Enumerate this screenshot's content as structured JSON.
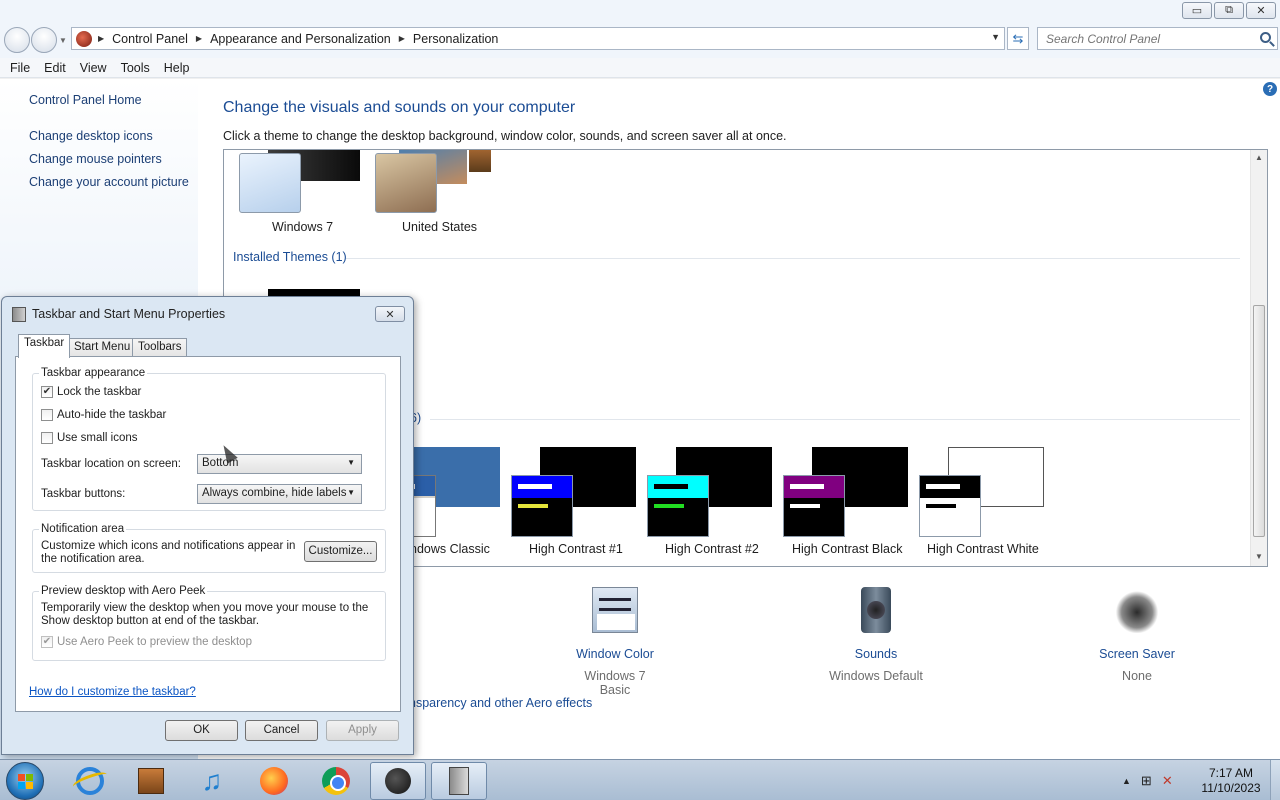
{
  "window": {
    "minimize_glyph": "▭",
    "maximize_glyph": "⧉",
    "close_glyph": "✕"
  },
  "address": {
    "crumbs": [
      "Control Panel",
      "Appearance and Personalization",
      "Personalization"
    ],
    "search_placeholder": "Search Control Panel"
  },
  "menu": [
    "File",
    "Edit",
    "View",
    "Tools",
    "Help"
  ],
  "sidebar": {
    "home": "Control Panel Home",
    "links": [
      "Change desktop icons",
      "Change mouse pointers",
      "Change your account picture"
    ]
  },
  "main": {
    "title": "Change the visuals and sounds on your computer",
    "subtitle": "Click a theme to change the desktop background, window color, sounds, and screen saver all at once.",
    "aero_themes": [
      {
        "name": "Windows 7"
      },
      {
        "name": "United States"
      }
    ],
    "installed_group": "Installed Themes (1)",
    "basic_group_suffix": "6)",
    "basic_themes": [
      {
        "name": "ndows Classic",
        "bar1": "#ffffff",
        "bar2": "#ffffff",
        "title": "#2b5fa8"
      },
      {
        "name": "High Contrast #1",
        "bar1": "#ffffff",
        "bar2": "#e5e53a",
        "title": "#0000ff"
      },
      {
        "name": "High Contrast #2",
        "bar1": "#000000",
        "bar2": "#22dd22",
        "title": "#00ffff"
      },
      {
        "name": "High Contrast Black",
        "bar1": "#ffffff",
        "bar2": "#ffffff",
        "title": "#800080"
      },
      {
        "name": "High Contrast White",
        "bar1": "#ffffff",
        "bar2": "#000000",
        "title": "#000000"
      }
    ],
    "bottom": [
      {
        "title": "Window Color",
        "sub": "Windows 7 Basic",
        "icon": "window-color-icon"
      },
      {
        "title": "Sounds",
        "sub": "Windows Default",
        "icon": "speaker-icon"
      },
      {
        "title": "Screen Saver",
        "sub": "None",
        "icon": "screen-saver-icon"
      }
    ],
    "aero_link": "nsparency and other Aero effects"
  },
  "dialog": {
    "title": "Taskbar and Start Menu Properties",
    "tabs": [
      "Taskbar",
      "Start Menu",
      "Toolbars"
    ],
    "appearance": {
      "title": "Taskbar appearance",
      "lock": {
        "label": "Lock the taskbar",
        "checked": true
      },
      "autohide": {
        "label": "Auto-hide the taskbar",
        "checked": false
      },
      "small": {
        "label": "Use small icons",
        "checked": false
      },
      "location_label": "Taskbar location on screen:",
      "location_value": "Bottom",
      "buttons_label": "Taskbar buttons:",
      "buttons_value": "Always combine, hide labels"
    },
    "notification": {
      "title": "Notification area",
      "text": "Customize which icons and notifications appear in the notification area.",
      "button": "Customize..."
    },
    "peek": {
      "title": "Preview desktop with Aero Peek",
      "text": "Temporarily view the desktop when you move your mouse to the Show desktop button at end of the taskbar.",
      "checkbox": "Use Aero Peek to preview the desktop",
      "checked": true
    },
    "help_link": "How do I customize the taskbar?",
    "ok": "OK",
    "cancel": "Cancel",
    "apply": "Apply"
  },
  "taskbar": {
    "apps": [
      "internet-explorer",
      "media-center",
      "music",
      "firefox",
      "chrome",
      "paint",
      "taskbar-properties"
    ],
    "time": "7:17 AM",
    "date": "11/10/2023"
  }
}
